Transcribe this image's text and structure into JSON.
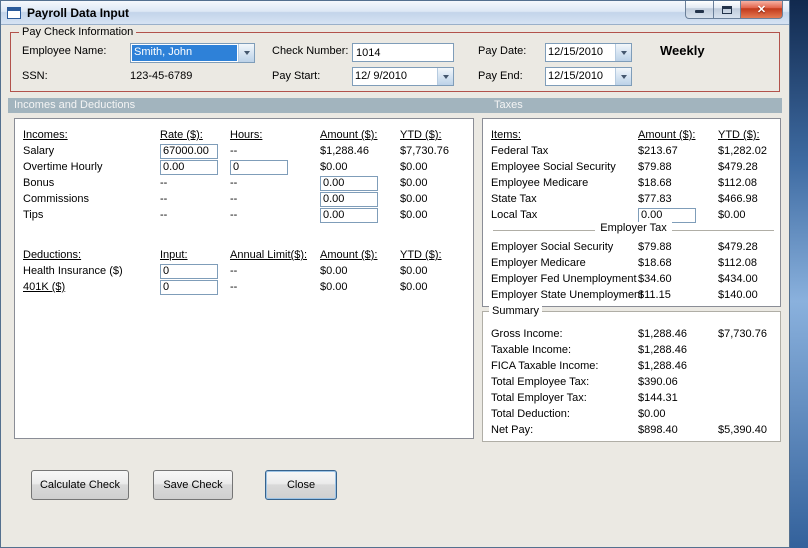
{
  "window": {
    "title": "Payroll Data Input",
    "close_glyph": "✕"
  },
  "colors": {
    "group_border": "#b2524b",
    "band_bg": "#a2b4be",
    "selection_blue": "#2e81d8",
    "close_red": "#c13a1c"
  },
  "paycheck": {
    "group_label": "Pay Check Information",
    "employee_name": {
      "label": "Employee Name:",
      "value": "Smith, John"
    },
    "ssn": {
      "label": "SSN:",
      "value": "123-45-6789"
    },
    "check_number": {
      "label": "Check Number:",
      "value": "1014"
    },
    "pay_start": {
      "label": "Pay Start:",
      "value": "12/ 9/2010"
    },
    "pay_date": {
      "label": "Pay Date:",
      "value": "12/15/2010"
    },
    "pay_end": {
      "label": "Pay End:",
      "value": "12/15/2010"
    },
    "frequency": "Weekly"
  },
  "section_headers": {
    "left": "Incomes and Deductions",
    "right": "Taxes"
  },
  "incomes_table": {
    "col_labels": [
      "Incomes:",
      "Rate ($):",
      "Hours:",
      "Amount ($):",
      "YTD ($):"
    ],
    "rows": [
      {
        "label": "Salary",
        "rate": "67000.00",
        "hours": "--",
        "amount": "$1,288.46",
        "ytd": "$7,730.76"
      },
      {
        "label": "Overtime Hourly",
        "rate": "0.00",
        "hours": "0",
        "amount": "$0.00",
        "ytd": "$0.00"
      },
      {
        "label": "Bonus",
        "rate": "--",
        "hours": "--",
        "amount": "0.00",
        "ytd": "$0.00"
      },
      {
        "label": "Commissions",
        "rate": "--",
        "hours": "--",
        "amount": "0.00",
        "ytd": "$0.00"
      },
      {
        "label": "Tips",
        "rate": "--",
        "hours": "--",
        "amount": "0.00",
        "ytd": "$0.00"
      }
    ]
  },
  "deductions_table": {
    "col_labels": [
      "Deductions:",
      "Input:",
      "Annual Limit($):",
      "Amount ($):",
      "YTD ($):"
    ],
    "rows": [
      {
        "label": "Health Insurance ($)",
        "input": "0",
        "limit": "--",
        "amount": "$0.00",
        "ytd": "$0.00"
      },
      {
        "label": "401K ($)",
        "input": "0",
        "limit": "--",
        "amount": "$0.00",
        "ytd": "$0.00"
      }
    ]
  },
  "taxes_table": {
    "col_labels": [
      "Items:",
      "Amount ($):",
      "YTD ($):"
    ],
    "rows": [
      {
        "label": "Federal Tax",
        "amount": "$213.67",
        "ytd": "$1,282.02"
      },
      {
        "label": "Employee Social Security",
        "amount": "$79.88",
        "ytd": "$479.28"
      },
      {
        "label": "Employee Medicare",
        "amount": "$18.68",
        "ytd": "$112.08"
      },
      {
        "label": "State Tax",
        "amount": "$77.83",
        "ytd": "$466.98"
      },
      {
        "label": "Local Tax",
        "amount": "0.00",
        "ytd": "$0.00"
      }
    ],
    "employer_header": "Employer Tax",
    "employer_rows": [
      {
        "label": "Employer Social Security",
        "amount": "$79.88",
        "ytd": "$479.28"
      },
      {
        "label": "Employer Medicare",
        "amount": "$18.68",
        "ytd": "$112.08"
      },
      {
        "label": "Employer Fed Unemployment",
        "amount": "$34.60",
        "ytd": "$434.00"
      },
      {
        "label": "Employer State Unemployment",
        "amount": "$11.15",
        "ytd": "$140.00"
      }
    ]
  },
  "summary": {
    "group_label": "Summary",
    "rows": [
      {
        "label": "Gross Income:",
        "amount": "$1,288.46",
        "ytd": "$7,730.76"
      },
      {
        "label": "Taxable Income:",
        "amount": "$1,288.46",
        "ytd": ""
      },
      {
        "label": "FICA Taxable Income:",
        "amount": "$1,288.46",
        "ytd": ""
      },
      {
        "label": "Total Employee Tax:",
        "amount": "$390.06",
        "ytd": ""
      },
      {
        "label": "Total Employer Tax:",
        "amount": "$144.31",
        "ytd": ""
      },
      {
        "label": "Total Deduction:",
        "amount": "$0.00",
        "ytd": ""
      },
      {
        "label": "Net Pay:",
        "amount": "$898.40",
        "ytd": "$5,390.40"
      }
    ]
  },
  "buttons": {
    "calculate": "Calculate Check",
    "save": "Save Check",
    "close": "Close"
  }
}
